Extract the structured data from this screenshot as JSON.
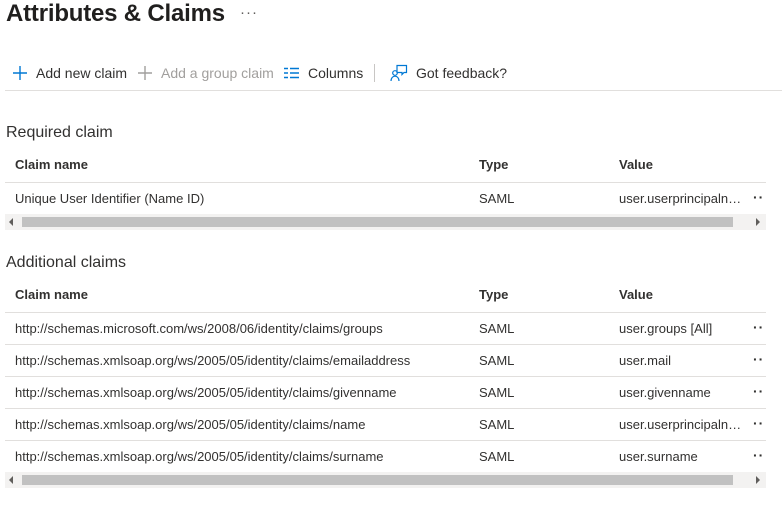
{
  "header": {
    "title": "Attributes & Claims",
    "more": "···"
  },
  "toolbar": {
    "add_new_claim": "Add new claim",
    "add_group_claim": "Add a group claim",
    "columns": "Columns",
    "feedback": "Got feedback?"
  },
  "required": {
    "title": "Required claim",
    "columns": [
      "Claim name",
      "Type",
      "Value"
    ],
    "rows": [
      {
        "name": "Unique User Identifier (Name ID)",
        "type": "SAML",
        "value": "user.userprincipalname"
      }
    ]
  },
  "additional": {
    "title": "Additional claims",
    "columns": [
      "Claim name",
      "Type",
      "Value"
    ],
    "rows": [
      {
        "name": "http://schemas.microsoft.com/ws/2008/06/identity/claims/groups",
        "type": "SAML",
        "value": "user.groups [All]"
      },
      {
        "name": "http://schemas.xmlsoap.org/ws/2005/05/identity/claims/emailaddress",
        "type": "SAML",
        "value": "user.mail"
      },
      {
        "name": "http://schemas.xmlsoap.org/ws/2005/05/identity/claims/givenname",
        "type": "SAML",
        "value": "user.givenname"
      },
      {
        "name": "http://schemas.xmlsoap.org/ws/2005/05/identity/claims/name",
        "type": "SAML",
        "value": "user.userprincipalname"
      },
      {
        "name": "http://schemas.xmlsoap.org/ws/2005/05/identity/claims/surname",
        "type": "SAML",
        "value": "user.surname"
      }
    ]
  },
  "row_more": "··",
  "colors": {
    "accent": "#0078d4",
    "disabled": "#a19f9d",
    "text": "#323130",
    "border": "#e1dfdd"
  },
  "icons": {
    "add": "add-icon",
    "group": "add-group-icon",
    "columns": "columns-icon",
    "feedback": "feedback-icon"
  }
}
